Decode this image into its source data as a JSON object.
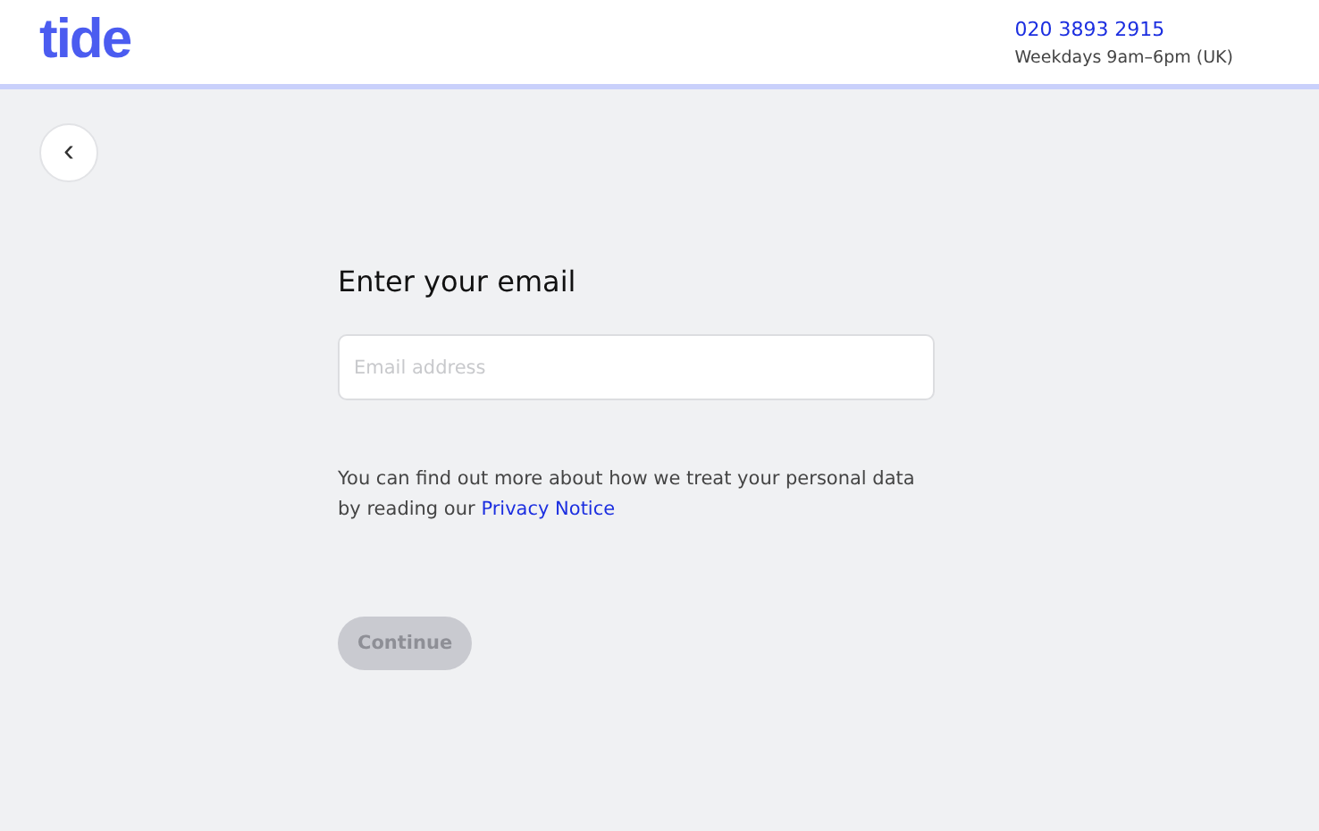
{
  "header": {
    "logo": "tide",
    "phone": "020 3893 2915",
    "hours": "Weekdays 9am–6pm (UK)"
  },
  "back_button": {
    "icon": "‹"
  },
  "form": {
    "title": "Enter your email",
    "email_field": {
      "placeholder": "Email address"
    },
    "notice": {
      "text": "You can find out more about how we treat your personal data by reading our",
      "link": "Privacy Notice"
    },
    "continue_button": {
      "label": "Continue",
      "disabled": true
    }
  }
}
